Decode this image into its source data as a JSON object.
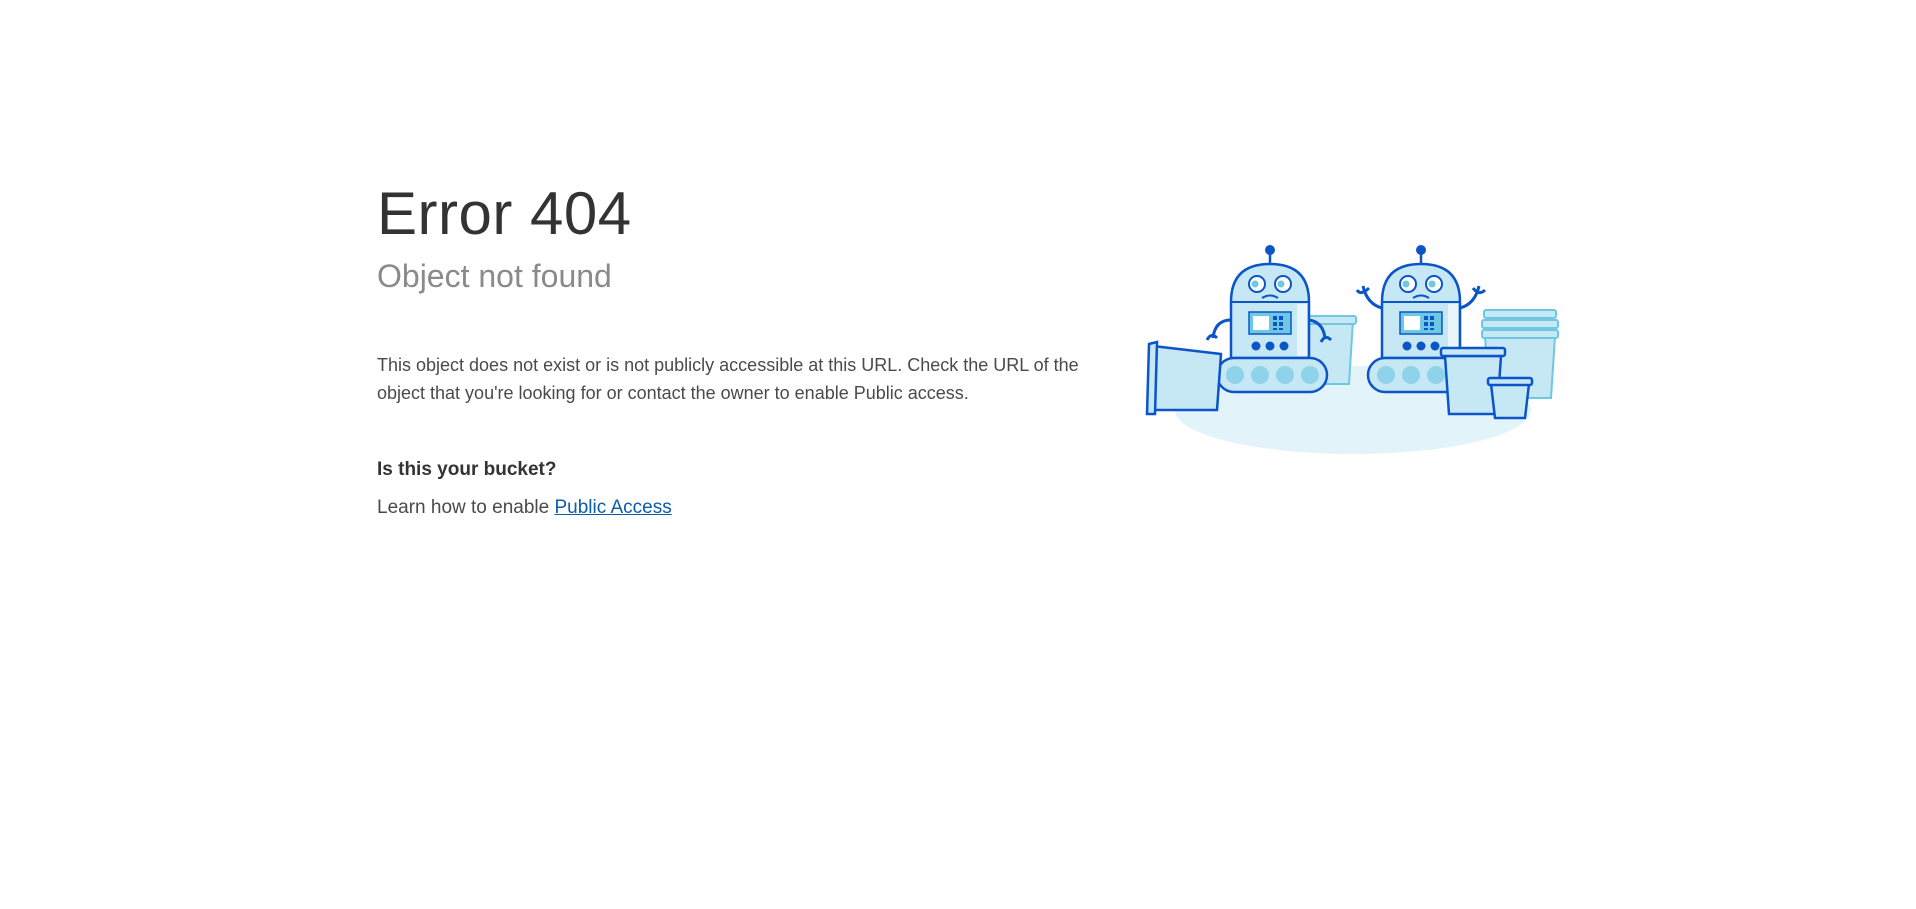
{
  "error": {
    "title": "Error 404",
    "subtitle": "Object not found",
    "description": "This object does not exist or is not publicly accessible at this URL. Check the URL of the object that you're looking for or contact the owner to enable Public access."
  },
  "bucket": {
    "question": "Is this your bucket?",
    "learn_prefix": "Learn how to enable ",
    "link_label": "Public Access"
  },
  "illustration": {
    "icon": "robots-with-buckets-illustration",
    "colors": {
      "outline": "#0b55c9",
      "fill_light": "#c6e8f4",
      "fill_mid": "#8fd3ea",
      "shadow": "#e2f3fa"
    }
  }
}
